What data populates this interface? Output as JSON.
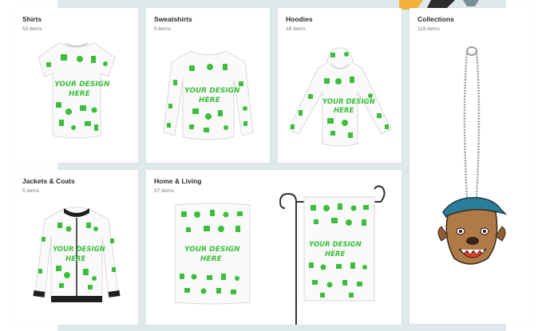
{
  "categories": [
    {
      "title": "Shirts",
      "count": "53 items"
    },
    {
      "title": "Sweatshirts",
      "count": "5 items"
    },
    {
      "title": "Hoodies",
      "count": "18 items"
    },
    {
      "title": "Collections",
      "count": "119 items"
    },
    {
      "title": "Jackets & Coats",
      "count": "5 items"
    },
    {
      "title": "Home & Living",
      "count": "57 items"
    }
  ],
  "print_text": {
    "line1": "YOUR DESIGN",
    "line2": "HERE"
  },
  "colors": {
    "pattern_green": "#3bbf3b",
    "background": "#dfe8ea",
    "card": "#ffffff"
  }
}
